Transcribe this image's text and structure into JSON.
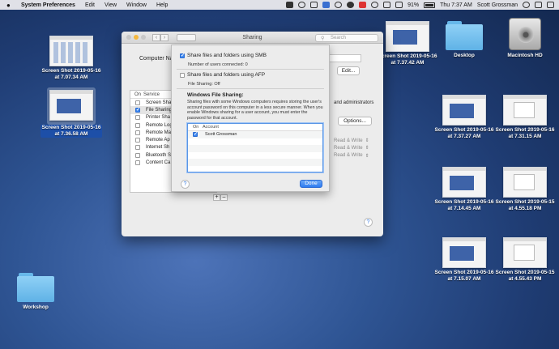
{
  "menubar": {
    "app": "System Preferences",
    "items": [
      "Edit",
      "View",
      "Window",
      "Help"
    ],
    "battery": "91%",
    "time": "Thu 7:37 AM",
    "user": "Scott Grossman"
  },
  "desktop": {
    "icons": [
      {
        "line1": "Screen Shot 2019-05-16",
        "line2": "at 7.07.34 AM"
      },
      {
        "line1": "Screen Shot 2019-05-16",
        "line2": "at 7.36.58 AM"
      },
      {
        "line1": "Screen Shot 2019-05-16",
        "line2": "at 7.37.42 AM"
      },
      {
        "line1": "Desktop",
        "line2": ""
      },
      {
        "line1": "Macintosh HD",
        "line2": ""
      },
      {
        "line1": "Screen Shot 2019-05-16",
        "line2": "at 7.37.27 AM"
      },
      {
        "line1": "Screen Shot 2019-05-16",
        "line2": "at 7.31.15 AM"
      },
      {
        "line1": "Screen Shot 2019-05-16",
        "line2": "at 7.14.45 AM"
      },
      {
        "line1": "Screen Shot 2019-05-15",
        "line2": "at 4.55.18 PM"
      },
      {
        "line1": "Screen Shot 2019-05-16",
        "line2": "at 7.15.07 AM"
      },
      {
        "line1": "Screen Shot 2019-05-15",
        "line2": "at 4.55.43 PM"
      },
      {
        "line1": "Workshop",
        "line2": ""
      }
    ]
  },
  "window": {
    "title": "Sharing",
    "search_placeholder": "Search",
    "computer_name_label": "Computer Na",
    "edit_label": "Edit...",
    "admin_note": "and administrators",
    "options_label": "Options...",
    "list_header": {
      "on": "On",
      "service": "Service"
    },
    "services": [
      {
        "name": "Screen Sha",
        "checked": false
      },
      {
        "name": "File Sharing",
        "checked": true
      },
      {
        "name": "Printer Sha",
        "checked": false
      },
      {
        "name": "Remote Log",
        "checked": false
      },
      {
        "name": "Remote Ma",
        "checked": false
      },
      {
        "name": "Remote Ap",
        "checked": false
      },
      {
        "name": "Internet Sh",
        "checked": false
      },
      {
        "name": "Bluetooth S",
        "checked": false
      },
      {
        "name": "Content Ca",
        "checked": false
      }
    ],
    "permissions": [
      "Read & Write",
      "Read & Write",
      "Read & Write"
    ],
    "help": "?"
  },
  "sheet": {
    "smb_label": "Share files and folders using SMB",
    "smb_checked": true,
    "users_connected": "Number of users connected: 0",
    "afp_label": "Share files and folders using AFP",
    "afp_checked": false,
    "afp_status": "File Sharing: Off",
    "windows_heading": "Windows File Sharing:",
    "windows_desc": "Sharing files with some Windows computers requires storing the user's account password on this computer in a less secure manner. When you enable Windows sharing for a user account, you must enter the password for that account.",
    "table_header": {
      "on": "On",
      "account": "Account"
    },
    "accounts": [
      {
        "name": "Scott Grossman",
        "checked": true
      }
    ],
    "done_label": "Done",
    "help": "?"
  },
  "colors": {
    "accent": "#2f7cf0",
    "desktop": "#2f5594"
  }
}
